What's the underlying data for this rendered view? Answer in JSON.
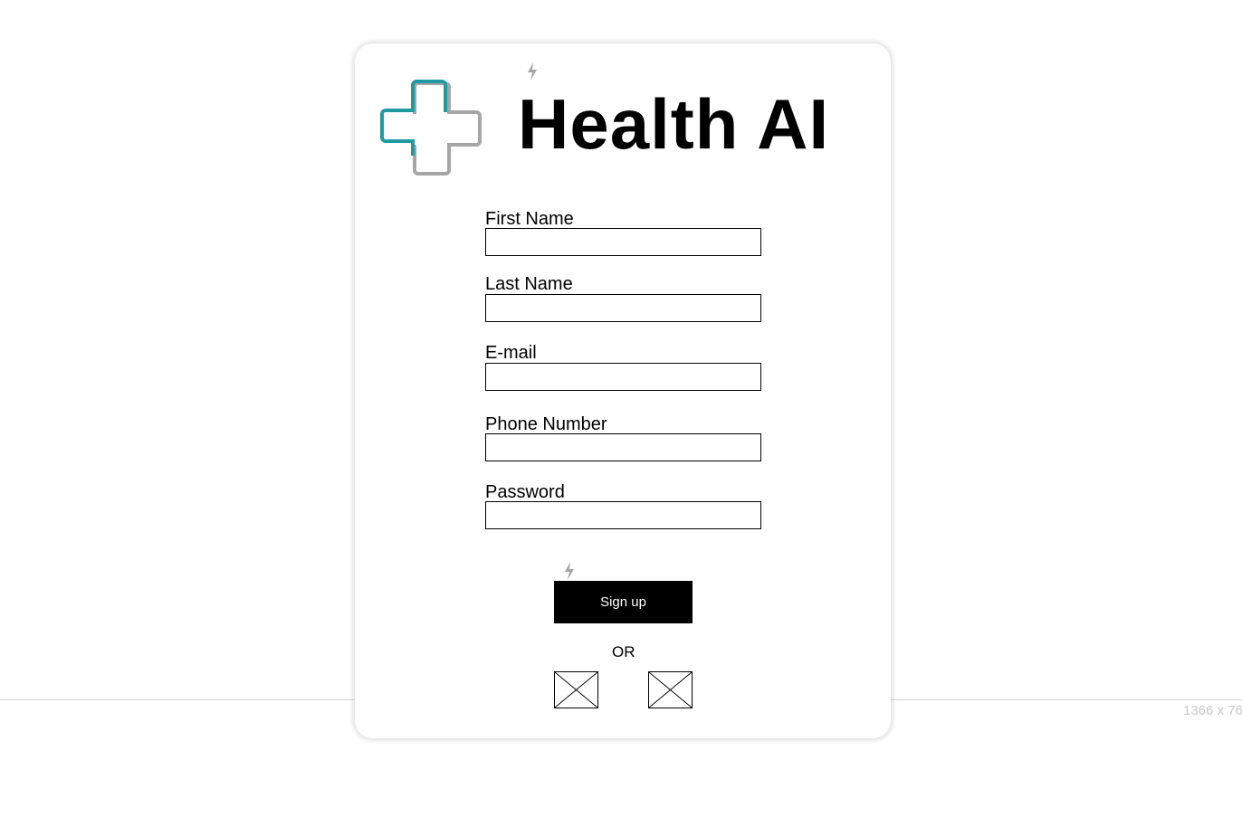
{
  "viewport": {
    "size_label": "1366 x 76"
  },
  "brand": {
    "title": "Health AI",
    "logo_icon": "medical-cross-icon",
    "colors": {
      "teal": "#1e9aa0",
      "gray": "#a6a6a6"
    }
  },
  "form": {
    "fields": [
      {
        "label": "First Name",
        "value": "",
        "placeholder": ""
      },
      {
        "label": "Last Name",
        "value": "",
        "placeholder": ""
      },
      {
        "label": "E-mail",
        "value": "",
        "placeholder": ""
      },
      {
        "label": "Phone Number",
        "value": "",
        "placeholder": ""
      },
      {
        "label": "Password",
        "value": "",
        "placeholder": ""
      }
    ],
    "submit_label": "Sign up",
    "divider_text": "OR"
  },
  "social": {
    "buttons": [
      {
        "icon": "image-placeholder-icon"
      },
      {
        "icon": "image-placeholder-icon"
      }
    ]
  },
  "icons": {
    "interaction_marker": "lightning-bolt-icon"
  }
}
